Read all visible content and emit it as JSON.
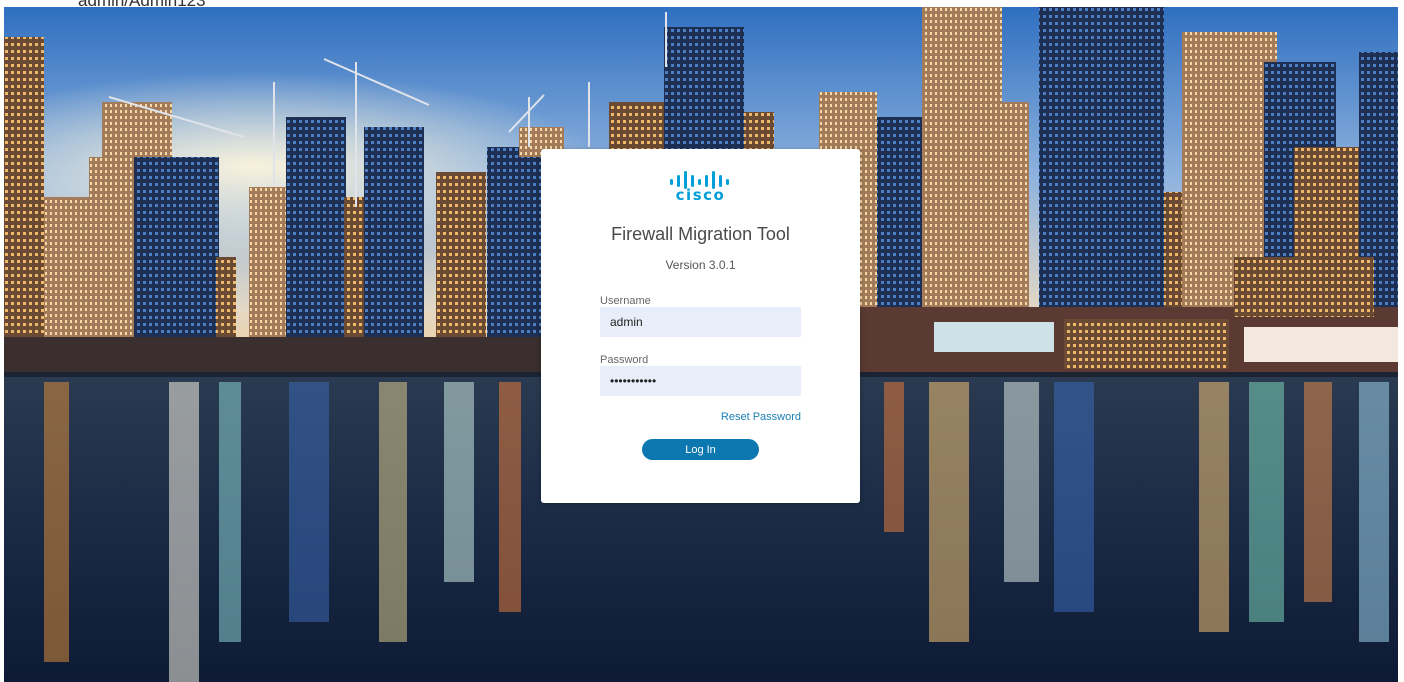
{
  "top_note": "admin/Admin123",
  "colors": {
    "brand": "#049fd9",
    "button": "#0d77b0",
    "link": "#1a7fb5",
    "input_bg": "#e8eef9"
  },
  "login": {
    "logo_icon": "cisco-logo-icon",
    "logo_text": "cisco",
    "title": "Firewall Migration Tool",
    "version": "Version 3.0.1",
    "username_label": "Username",
    "username_value": "admin",
    "password_label": "Password",
    "password_value": "Admin123456",
    "reset_password_label": "Reset Password",
    "login_label": "Log In"
  }
}
